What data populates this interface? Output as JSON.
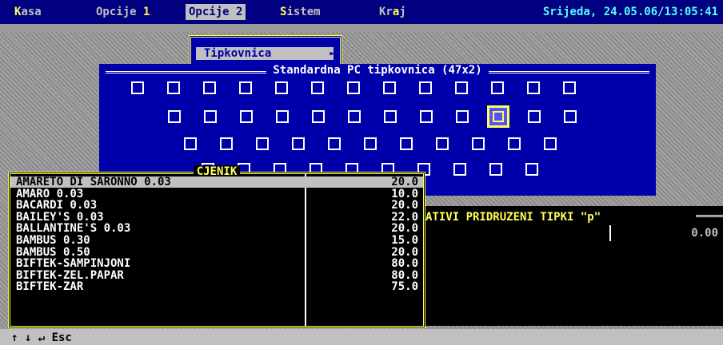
{
  "menubar": {
    "items": [
      {
        "hot": "K",
        "rest": "asa"
      },
      {
        "pre": "Opcije ",
        "hot": "1",
        "rest": ""
      },
      {
        "pre": "Opcije 2",
        "hot": "",
        "rest": ""
      },
      {
        "hot": "S",
        "rest": "istem"
      },
      {
        "pre": "Kr",
        "hot": "a",
        "rest": "j"
      }
    ],
    "datetime": "Srijeda, 24.05.06/13:05:41"
  },
  "submenu": {
    "item": "Tipkovnica",
    "arrow": "►"
  },
  "keyboard": {
    "title": "Standardna PC tipkovnica (47x2)",
    "rows": [
      13,
      12,
      11,
      10
    ],
    "active_key": {
      "row": 1,
      "index": 9
    }
  },
  "assign": {
    "title": "ATIVI PRIDRUZENI TIPKI \"p\"",
    "separator": "|",
    "value": "0.00"
  },
  "cjenik": {
    "title": "CJENIK",
    "items": [
      {
        "name": "AMARETO DI SARONNO 0.03",
        "price": "20.0"
      },
      {
        "name": "AMARO 0.03",
        "price": "10.0"
      },
      {
        "name": "BACARDI 0.03",
        "price": "20.0"
      },
      {
        "name": "BAILEY'S 0.03",
        "price": "22.0"
      },
      {
        "name": "BALLANTINE'S 0.03",
        "price": "20.0"
      },
      {
        "name": "BAMBUS 0.30",
        "price": "15.0"
      },
      {
        "name": "BAMBUS 0.50",
        "price": "20.0"
      },
      {
        "name": "BIFTEK-SAMPINJONI",
        "price": "80.0"
      },
      {
        "name": "BIFTEK-ZEL.PAPAR",
        "price": "80.0"
      },
      {
        "name": "BIFTEK-ZAR",
        "price": "75.0"
      }
    ],
    "selected_index": 0
  },
  "status": {
    "text": "↑ ↓ ↵ Esc"
  },
  "colors": {
    "menu_bg": "#000080",
    "dialog_bg": "#0000aa",
    "highlight": "#ffff54",
    "datetime": "#54ffff"
  }
}
